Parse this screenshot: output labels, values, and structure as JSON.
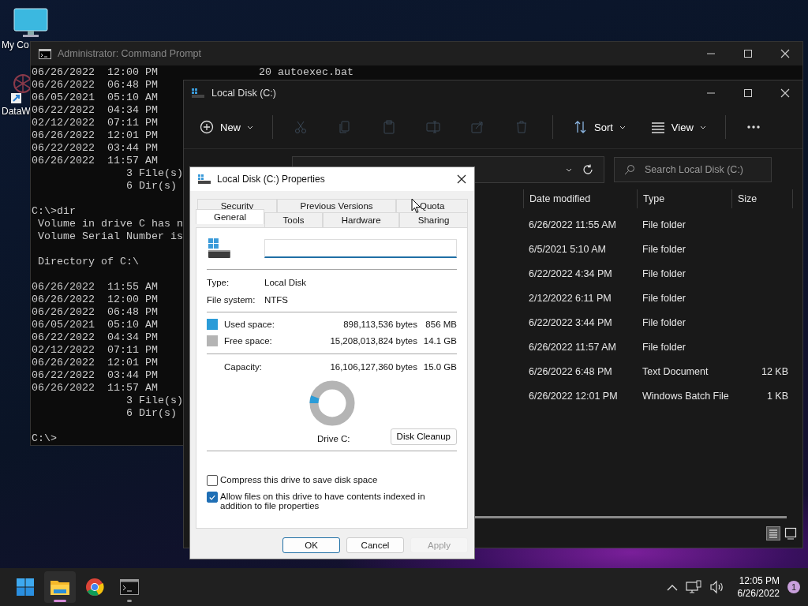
{
  "desktop_icons": [
    {
      "kind": "monitor",
      "label": "My Co"
    },
    {
      "kind": "shortcut",
      "label": "DataW"
    }
  ],
  "cmd_window": {
    "title": "Administrator: Command Prompt",
    "blocks": [
      [
        "06/26/2022  12:00 PM                20 autoexec.bat",
        "06/26/2022  06:48 PM",
        "06/05/2021  05:10 AM",
        "06/22/2022  04:34 PM",
        "02/12/2022  07:11 PM",
        "06/26/2022  12:01 PM",
        "06/22/2022  03:44 PM",
        "06/26/2022  11:57 AM",
        "               3 File(s)",
        "               6 Dir(s)"
      ],
      [
        "C:\\>dir",
        " Volume in drive C has n",
        " Volume Serial Number is"
      ],
      [
        " Directory of C:\\"
      ],
      [
        "06/26/2022  11:55 AM",
        "06/26/2022  12:00 PM",
        "06/26/2022  06:48 PM",
        "06/05/2021  05:10 AM",
        "06/22/2022  04:34 PM",
        "02/12/2022  07:11 PM",
        "06/26/2022  12:01 PM",
        "06/22/2022  03:44 PM",
        "06/26/2022  11:57 AM",
        "               3 File(s)",
        "               6 Dir(s)"
      ],
      [
        "C:\\>"
      ]
    ]
  },
  "explorer": {
    "title": "Local Disk (C:)",
    "toolbar": [
      {
        "kind": "new",
        "label": "New",
        "disabled": false
      },
      {
        "kind": "cut",
        "disabled": true
      },
      {
        "kind": "copy",
        "disabled": true
      },
      {
        "kind": "paste",
        "disabled": true
      },
      {
        "kind": "rename",
        "disabled": true
      },
      {
        "kind": "share",
        "disabled": true
      },
      {
        "kind": "delete",
        "disabled": true
      },
      {
        "kind": "sort",
        "label": "Sort",
        "disabled": false
      },
      {
        "kind": "view",
        "label": "View",
        "disabled": false
      },
      {
        "kind": "more",
        "disabled": false
      }
    ],
    "search": {
      "placeholder": "Search Local Disk (C:)"
    },
    "columns": [
      "Date modified",
      "Type",
      "Size"
    ],
    "rows": [
      {
        "date": "6/26/2022 11:55 AM",
        "type": "File folder"
      },
      {
        "date": "6/5/2021 5:10 AM",
        "type": "File folder"
      },
      {
        "date": "6/22/2022 4:34 PM",
        "type": "File folder"
      },
      {
        "date": "2/12/2022 6:11 PM",
        "type": "File folder"
      },
      {
        "date": "6/22/2022 3:44 PM",
        "type": "File folder"
      },
      {
        "date": "6/26/2022 11:57 AM",
        "type": "File folder"
      },
      {
        "date": "6/26/2022 6:48 PM",
        "type": "Text Document",
        "size": "12 KB"
      },
      {
        "date": "6/26/2022 12:01 PM",
        "type": "Windows Batch File",
        "size": "1 KB"
      }
    ]
  },
  "dialog": {
    "title": "Local Disk (C:) Properties",
    "tabs_back": [
      {
        "label": "Security",
        "selected": false
      },
      {
        "label": "Previous Versions",
        "selected": false
      },
      {
        "label": "Quota",
        "selected": false
      }
    ],
    "tabs_front": [
      {
        "label": "General",
        "selected": true
      },
      {
        "label": "Tools",
        "selected": false
      },
      {
        "label": "Hardware",
        "selected": false
      },
      {
        "label": "Sharing",
        "selected": false
      }
    ],
    "info": [
      {
        "label": "Type:",
        "value": "Local Disk"
      },
      {
        "label": "File system:",
        "value": "NTFS"
      }
    ],
    "space": [
      {
        "label": "Used space:",
        "bytes": "898,113,536 bytes",
        "size": "856 MB",
        "color": "#2b9cd8"
      },
      {
        "label": "Free space:",
        "bytes": "15,208,013,824 bytes",
        "size": "14.1 GB",
        "color": "#b4b4b4"
      }
    ],
    "capacity": {
      "label": "Capacity:",
      "bytes": "16,106,127,360 bytes",
      "size": "15.0 GB"
    },
    "donut": {
      "level": 0.056
    },
    "drive_label": "Drive C:",
    "cleanup": "Disk Cleanup",
    "checkboxes": [
      {
        "label": "Compress this drive to save disk space",
        "checked": false
      },
      {
        "label": "Allow files on this drive to have contents indexed in addition to file properties",
        "checked": true
      }
    ],
    "buttons": [
      {
        "label": "OK",
        "kind": "default"
      },
      {
        "label": "Cancel",
        "kind": "normal"
      },
      {
        "label": "Apply",
        "kind": "disabled"
      }
    ]
  },
  "taskbar": {
    "apps": [
      {
        "kind": "start",
        "active": false,
        "running": false
      },
      {
        "kind": "explorer",
        "active": true,
        "running": true
      },
      {
        "kind": "browser",
        "active": false,
        "running": false
      },
      {
        "kind": "terminal",
        "active": false,
        "running": true
      }
    ],
    "time": "12:05 PM",
    "date": "6/26/2022",
    "notifications": "1"
  }
}
